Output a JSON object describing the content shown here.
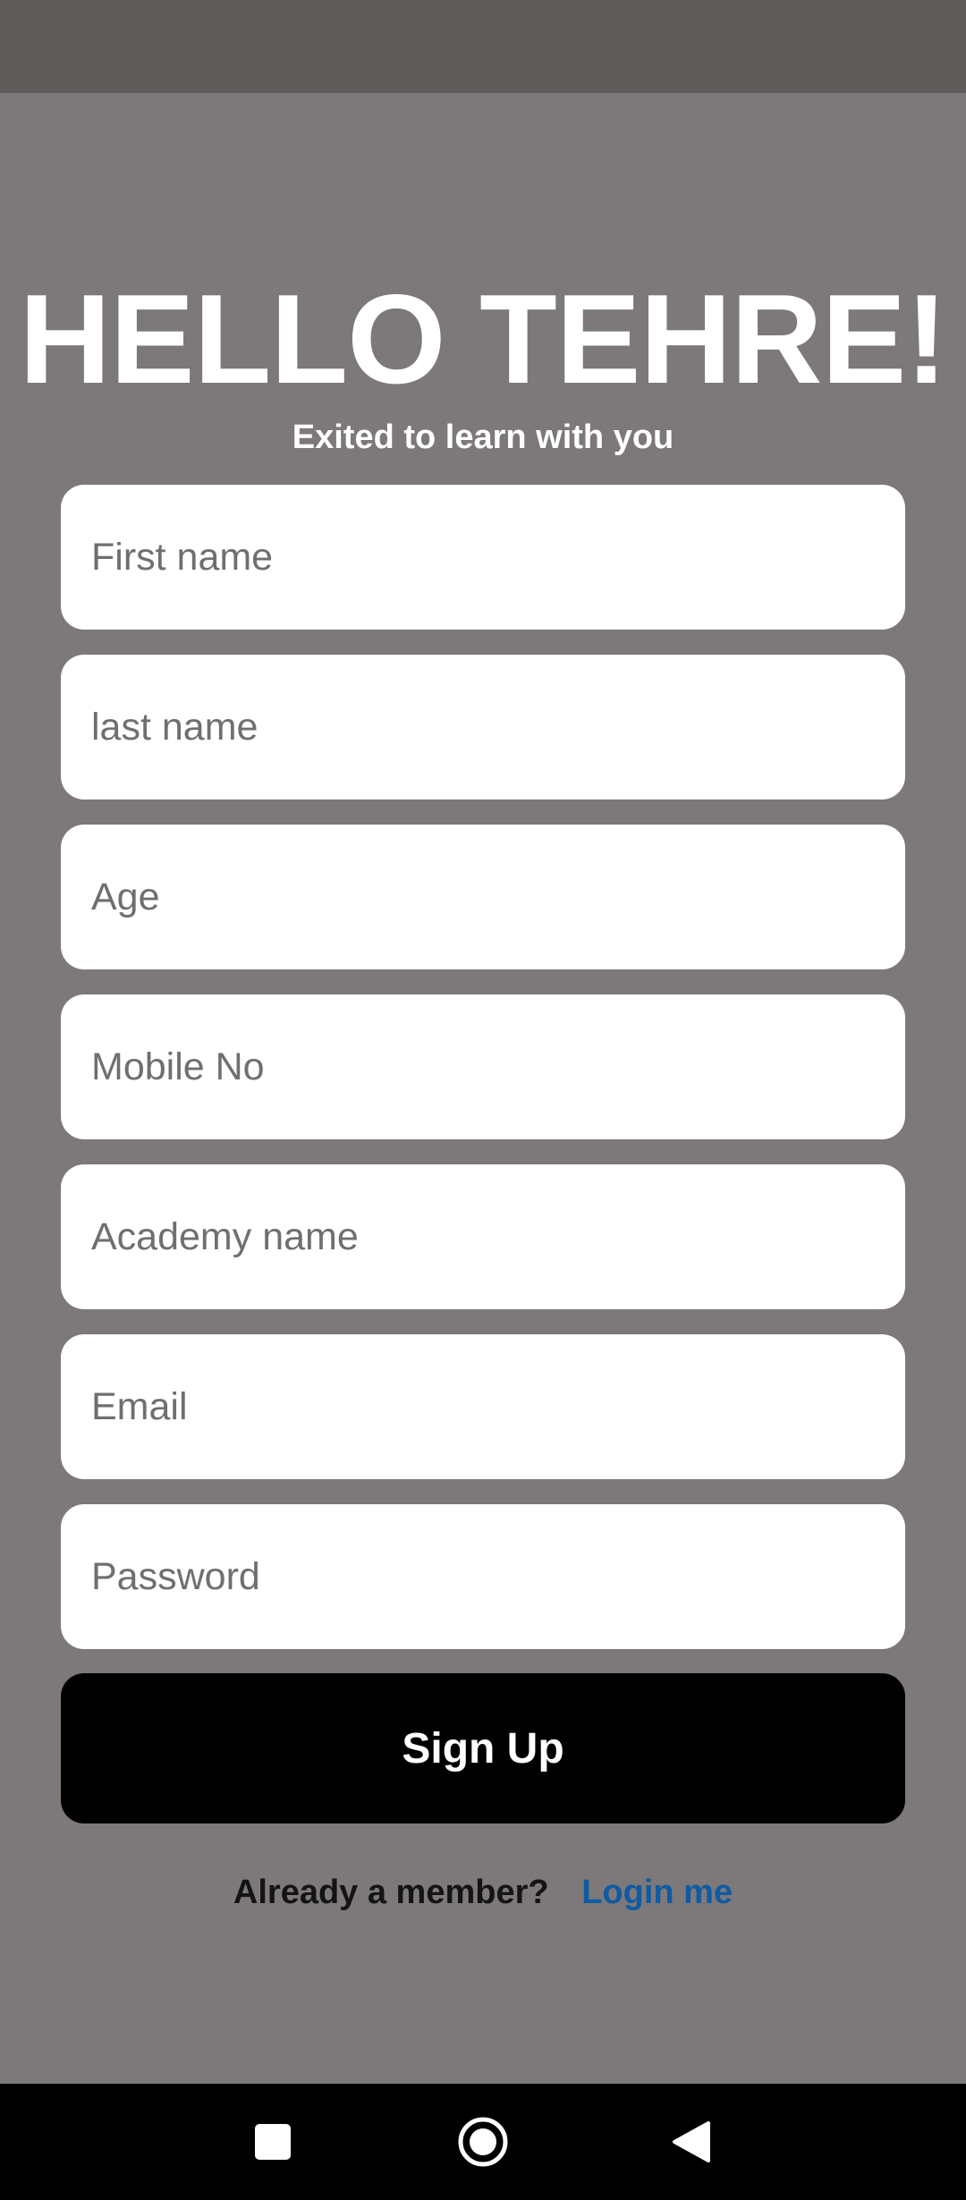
{
  "header": {
    "title": "HELLO TEHRE!",
    "subtitle": "Exited to learn with you"
  },
  "form": {
    "fields": [
      {
        "name": "first-name",
        "placeholder": "First name",
        "value": ""
      },
      {
        "name": "last-name",
        "placeholder": "last name",
        "value": ""
      },
      {
        "name": "age",
        "placeholder": "Age",
        "value": ""
      },
      {
        "name": "mobile-no",
        "placeholder": "Mobile No",
        "value": ""
      },
      {
        "name": "academy-name",
        "placeholder": "Academy name",
        "value": ""
      },
      {
        "name": "email",
        "placeholder": "Email",
        "value": ""
      },
      {
        "name": "password",
        "placeholder": "Password",
        "value": ""
      }
    ],
    "submit_label": "Sign Up"
  },
  "footer": {
    "prompt": "Already a member?",
    "link_label": "Login me"
  },
  "navigation": {
    "icons": [
      "recent-apps-icon",
      "home-icon",
      "back-icon"
    ]
  },
  "colors": {
    "background": "#7d7879",
    "status_bar": "#5f5b5b",
    "button": "#000000",
    "link": "#0f5ba3"
  }
}
